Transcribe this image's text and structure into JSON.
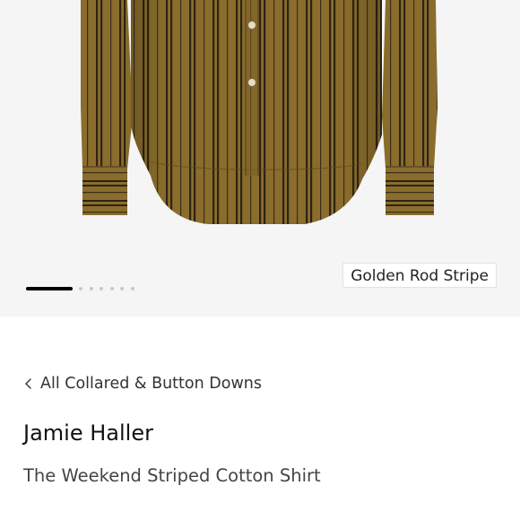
{
  "gallery": {
    "background": "#f5f5f5",
    "image": {
      "description_icon": "striped-shirt-image",
      "shirt_color": "#8a6d2c",
      "stripe_color": "#2e2414"
    },
    "pager": {
      "total": 7,
      "active_index": 0
    },
    "color_label": "Golden Rod Stripe"
  },
  "breadcrumb": {
    "icon": "chevron-left-icon",
    "label": "All Collared & Button Downs"
  },
  "product": {
    "brand": "Jamie Haller",
    "name": "The Weekend Striped Cotton Shirt"
  }
}
